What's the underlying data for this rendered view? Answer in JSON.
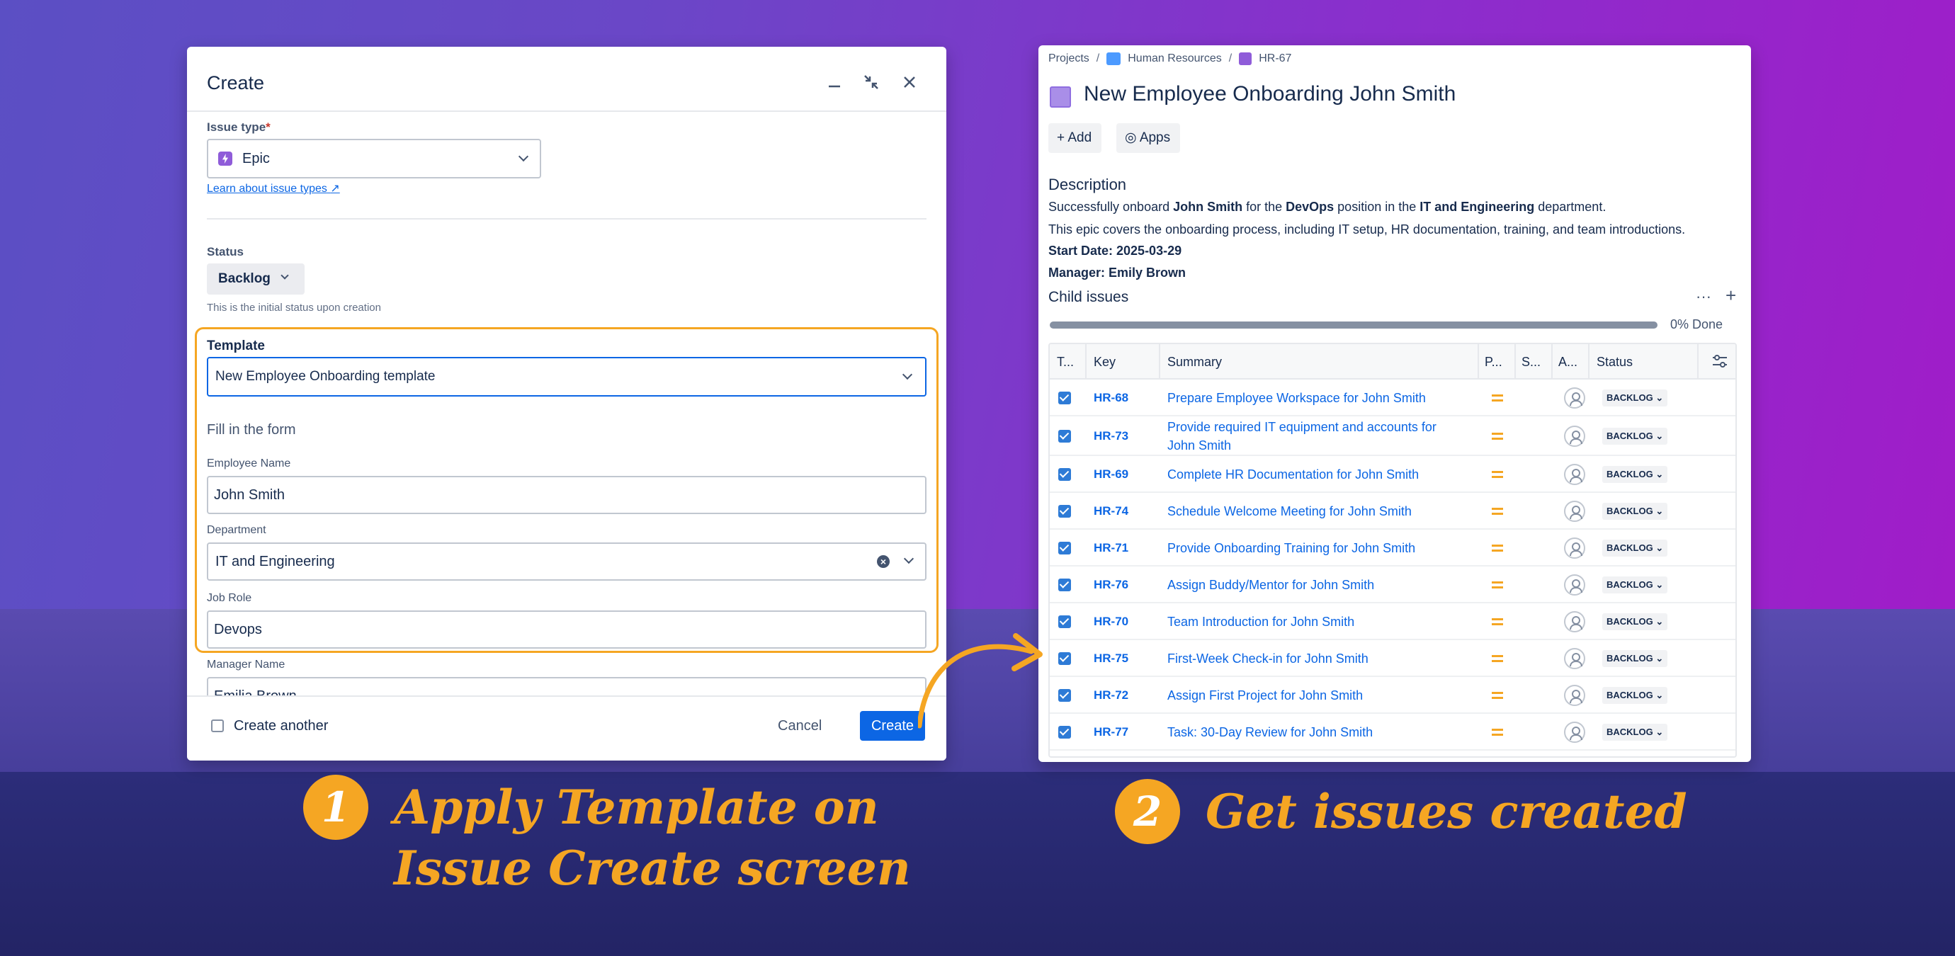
{
  "dialog": {
    "title": "Create",
    "issue_type_label": "Issue type",
    "issue_type_value": "Epic",
    "learn_link": "Learn about issue types",
    "status_label": "Status",
    "status_value": "Backlog",
    "status_hint": "This is the initial status upon creation",
    "template_label": "Template",
    "template_value": "New Employee Onboarding template",
    "fill_form": "Fill in the form",
    "employee_name_label": "Employee Name",
    "employee_name_value": "John Smith",
    "department_label": "Department",
    "department_value": "IT and Engineering",
    "job_role_label": "Job Role",
    "job_role_value": "Devops",
    "manager_name_label": "Manager Name",
    "manager_name_value": "Emilia Brown",
    "create_another": "Create another",
    "cancel": "Cancel",
    "create": "Create"
  },
  "panel": {
    "breadcrumbs": [
      "Projects",
      "Human Resources",
      "HR-67"
    ],
    "title": "New Employee Onboarding John Smith",
    "add_btn": "Add",
    "apps_btn": "Apps",
    "description_heading": "Description",
    "desc_line1_a": "Successfully onboard ",
    "desc_line1_b": "John Smith",
    "desc_line1_c": " for the ",
    "desc_line1_d": "DevOps",
    "desc_line1_e": " position in the ",
    "desc_line1_f": "IT and Engineering",
    "desc_line1_g": " department.",
    "desc_line2": "This epic covers the onboarding process, including IT setup, HR documentation, training, and team introductions.",
    "start_date": "Start Date: 2025-03-29",
    "manager": "Manager: Emily Brown",
    "child_issues": "Child issues",
    "progress_text": "0% Done",
    "progress": 0,
    "columns": [
      "T...",
      "Key",
      "Summary",
      "P...",
      "S...",
      "A...",
      "Status"
    ],
    "rows": [
      {
        "key": "HR-68",
        "summary": "Prepare Employee Workspace for John Smith",
        "status": "BACKLOG"
      },
      {
        "key": "HR-73",
        "summary": "Provide required IT equipment and accounts for John Smith",
        "status": "BACKLOG"
      },
      {
        "key": "HR-69",
        "summary": "Complete HR Documentation for John Smith",
        "status": "BACKLOG"
      },
      {
        "key": "HR-74",
        "summary": "Schedule Welcome Meeting for John Smith",
        "status": "BACKLOG"
      },
      {
        "key": "HR-71",
        "summary": "Provide Onboarding Training for John Smith",
        "status": "BACKLOG"
      },
      {
        "key": "HR-76",
        "summary": "Assign Buddy/Mentor for John Smith",
        "status": "BACKLOG"
      },
      {
        "key": "HR-70",
        "summary": "Team Introduction for John Smith",
        "status": "BACKLOG"
      },
      {
        "key": "HR-75",
        "summary": "First-Week Check-in for John Smith",
        "status": "BACKLOG"
      },
      {
        "key": "HR-72",
        "summary": "Assign First Project for John Smith",
        "status": "BACKLOG"
      },
      {
        "key": "HR-77",
        "summary": "Task: 30-Day Review for John Smith",
        "status": "BACKLOG"
      }
    ]
  },
  "callouts": {
    "step1_number": "1",
    "step1_line1": "Apply Template on",
    "step1_line2": "Issue Create screen",
    "step2_number": "2",
    "step2_text": "Get issues created"
  },
  "colors": {
    "accent": "#f5a623",
    "link": "#0c66e4",
    "epic": "#8f5cd9"
  }
}
